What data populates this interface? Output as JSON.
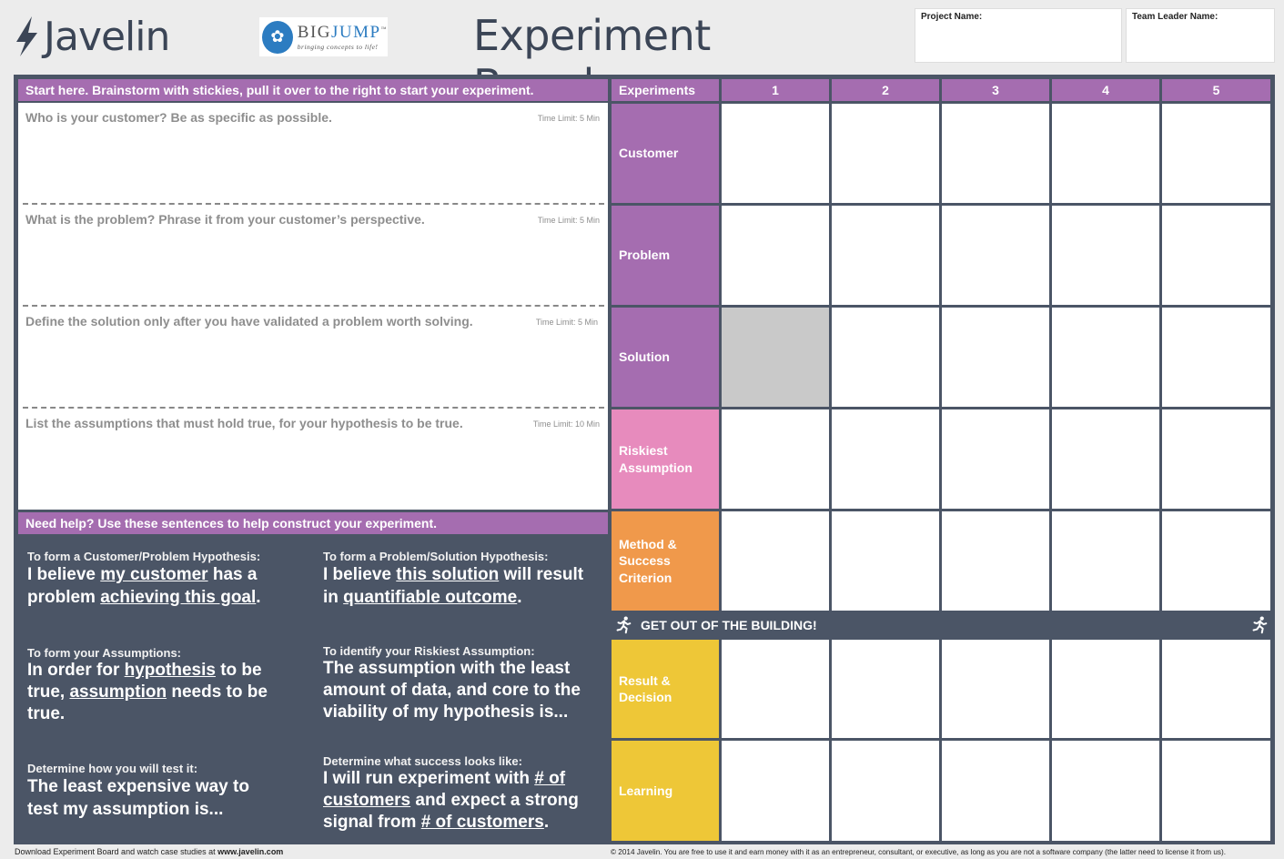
{
  "header": {
    "brand": "Javelin",
    "partner_word_1": "BIG",
    "partner_word_2": "JUMP",
    "partner_tm": "™",
    "partner_tagline": "bringing concepts to life!",
    "title": "Experiment Board",
    "project_label": "Project Name:",
    "leader_label": "Team Leader Name:"
  },
  "brainstorm": {
    "header": "Start here. Brainstorm with stickies, pull it over to the right to start your experiment.",
    "rows": [
      {
        "question": "Who is your customer? Be as specific as possible.",
        "time": "Time Limit: 5 Min"
      },
      {
        "question": "What is the problem? Phrase it from your customer’s perspective.",
        "time": "Time Limit: 5 Min"
      },
      {
        "question": "Define the solution only after you have validated a problem worth solving.",
        "time": "Time Limit: 5 Min"
      },
      {
        "question": "List the assumptions that must hold true, for your hypothesis to be true.",
        "time": "Time Limit: 10 Min"
      }
    ]
  },
  "help": {
    "header": "Need help? Use these sentences to help construct your experiment.",
    "c1": {
      "label": "To form a Customer/Problem Hypothesis:",
      "a": "I believe ",
      "u1": "my customer",
      "b": " has a problem ",
      "u2": "achieving this goal",
      "c": "."
    },
    "c2": {
      "label": "To form a Problem/Solution Hypothesis:",
      "a": "I believe ",
      "u1": "this solution",
      "b": " will result in ",
      "u2": "quantifiable outcome",
      "c": "."
    },
    "c3": {
      "label": "To form your Assumptions:",
      "a": "In order for ",
      "u1": "hypothesis",
      "b": " to be true, ",
      "u2": "assumption",
      "c": " needs to be true."
    },
    "c4": {
      "label": "To identify your Riskiest Assumption:",
      "text": "The assumption with the least amount of data, and core to the viability of my hypothesis is..."
    },
    "c5": {
      "label": "Determine how you will test it:",
      "text": "The least expensive way to test my assumption is..."
    },
    "c6": {
      "label": "Determine what success looks like:",
      "a": "I will run experiment with ",
      "u1": "# of customers",
      "b": " and expect a strong signal from ",
      "u2": "# of customers",
      "c": "."
    }
  },
  "grid": {
    "corner": "Experiments",
    "columns": [
      "1",
      "2",
      "3",
      "4",
      "5"
    ],
    "rows": [
      {
        "label": "Customer"
      },
      {
        "label": "Problem"
      },
      {
        "label": "Solution"
      },
      {
        "label": "Riskiest Assumption"
      },
      {
        "label": "Method & Success Criterion"
      },
      {
        "label": "Result & Decision"
      },
      {
        "label": "Learning"
      }
    ],
    "divider": "GET OUT OF THE BUILDING!",
    "colors": {
      "purple": "#a56db0",
      "pink": "#e78bbd",
      "orange": "#f0994b",
      "yellow": "#eec737",
      "dark": "#4b5566"
    }
  },
  "footer": {
    "left_text": "Download Experiment Board and watch case studies at ",
    "left_link": "www.javelin.com",
    "right": "© 2014 Javelin. You are free to use it and earn money with it as an entrepreneur, consultant, or executive, as long as you are not a software company (the latter need to license it from us)."
  }
}
